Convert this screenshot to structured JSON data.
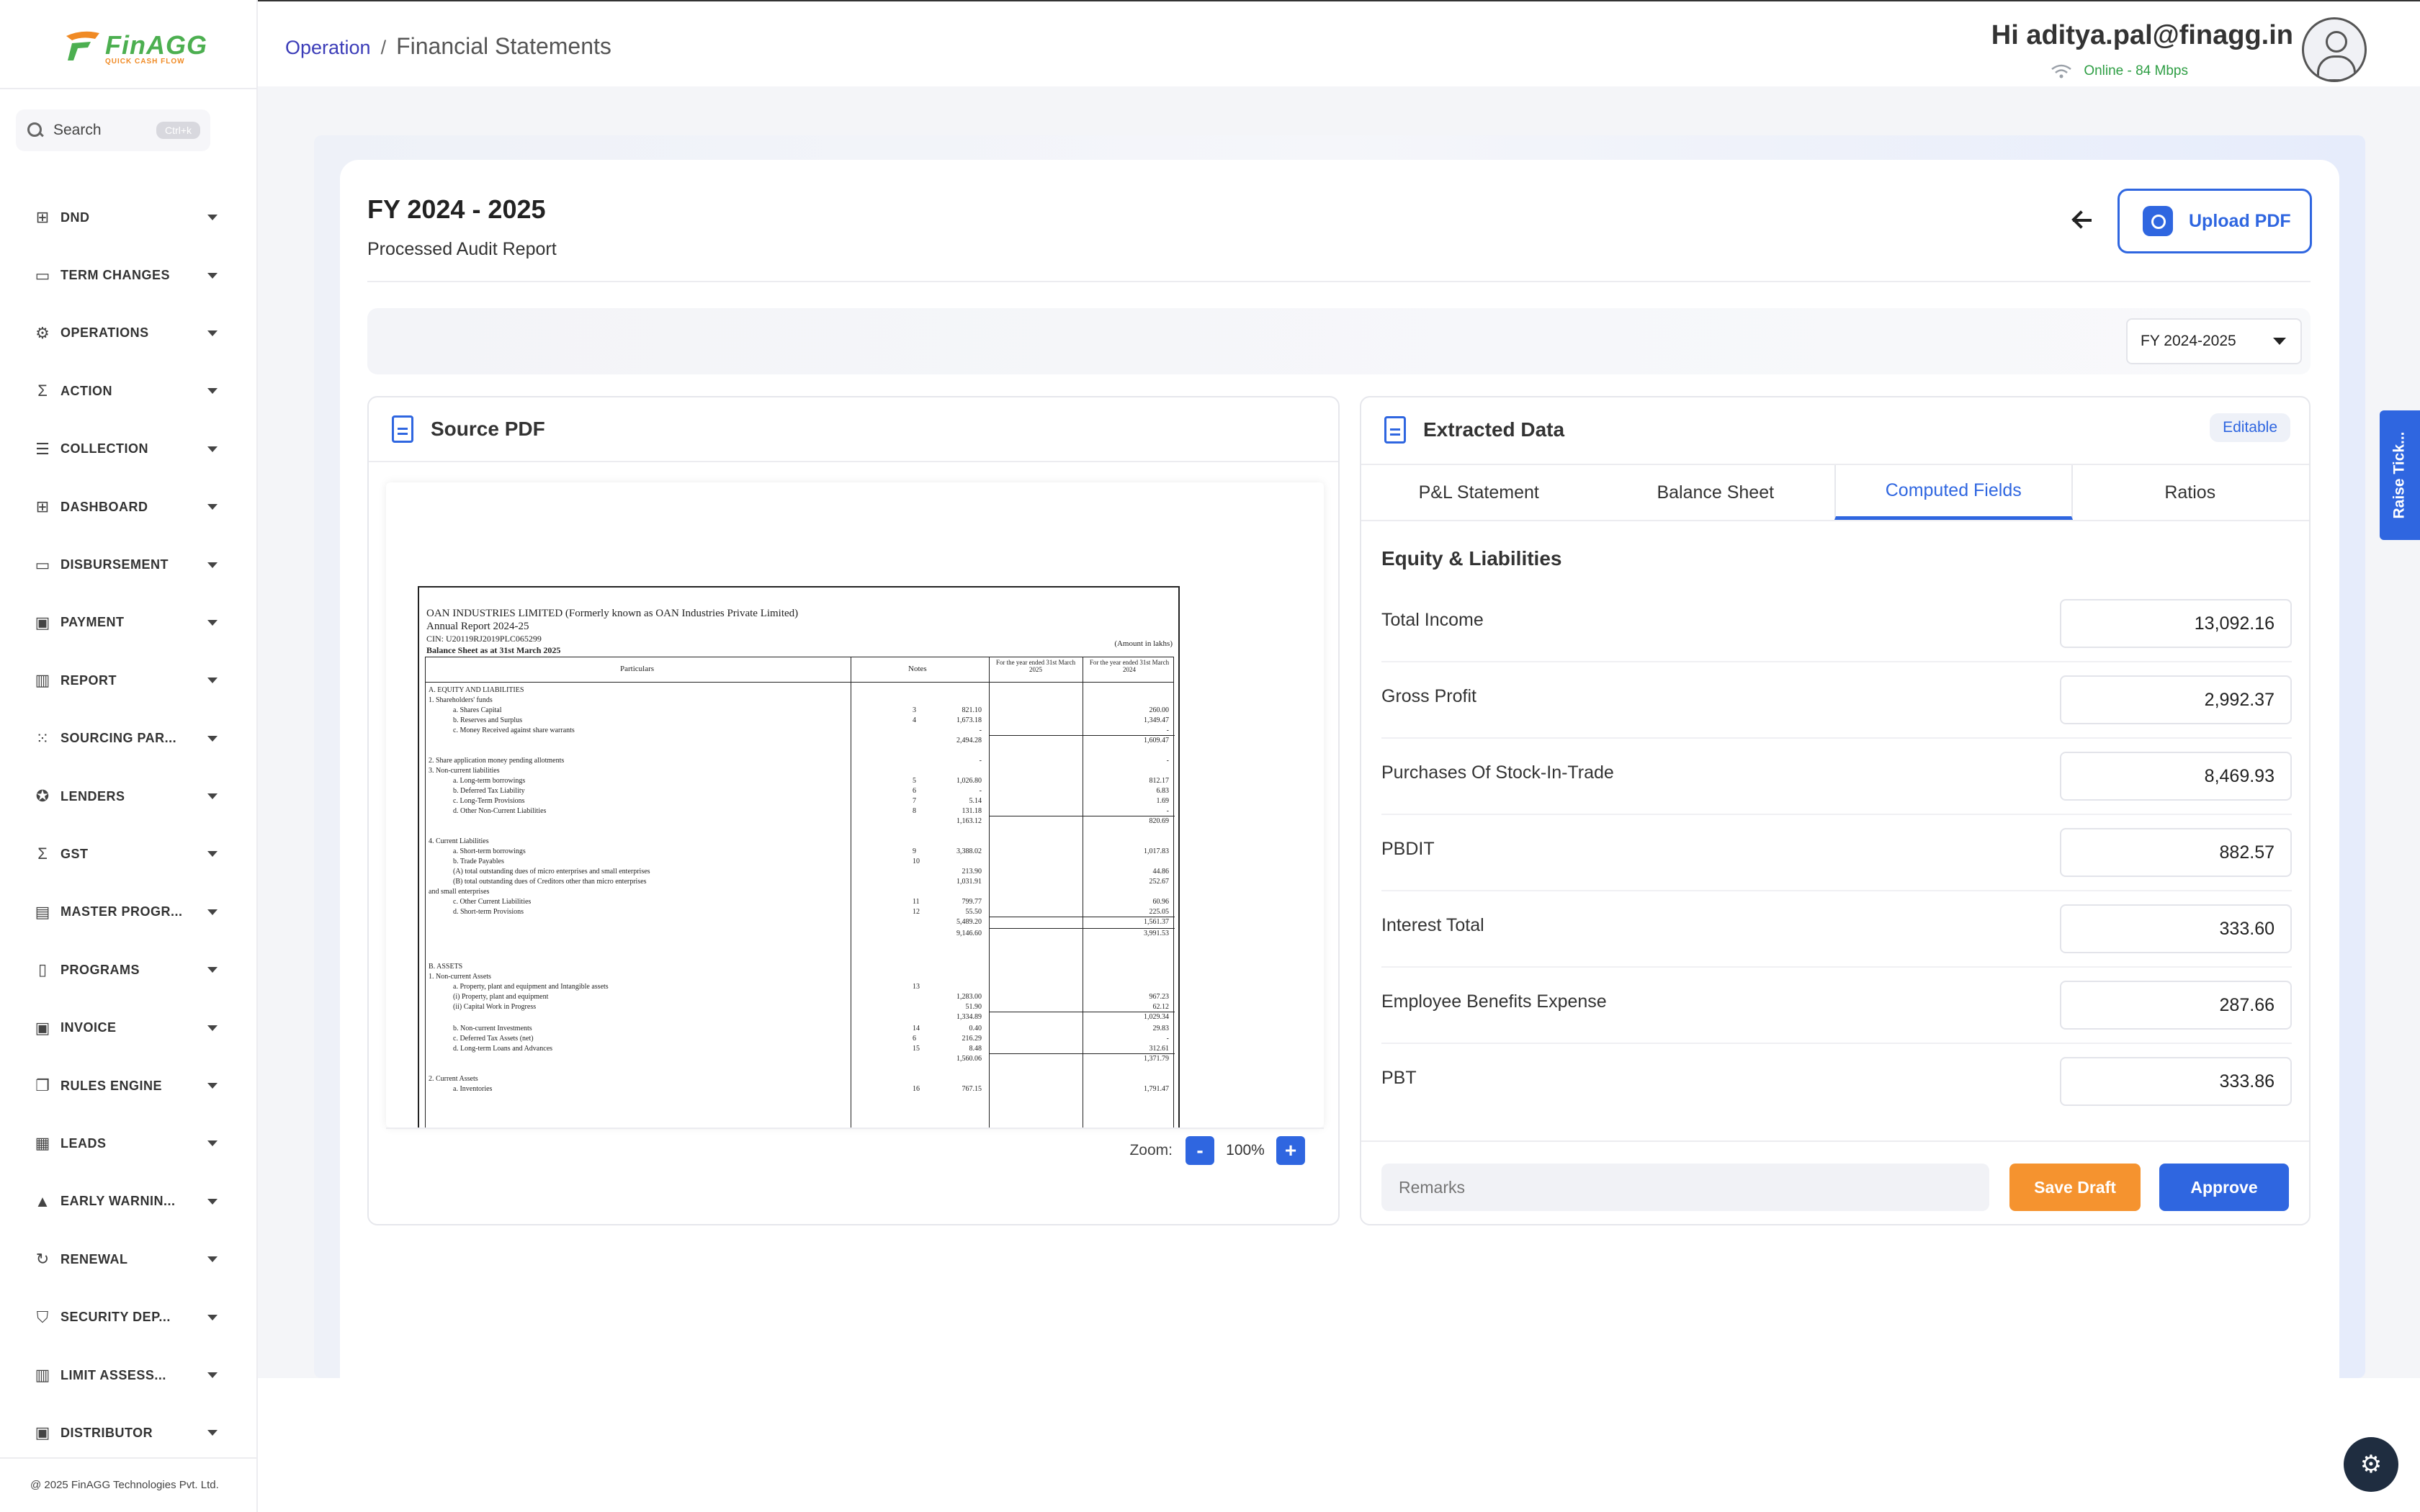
{
  "brand": {
    "name": "FinAGG",
    "tagline": "QUICK CASH FLOW",
    "copyright": "@ 2025 FinAGG Technologies Pvt. Ltd."
  },
  "search": {
    "placeholder": "Search",
    "shortcut": "Ctrl+k"
  },
  "sidebar": {
    "items": [
      {
        "label": "DND",
        "icon": "grid-icon",
        "glyph": "⊞"
      },
      {
        "label": "TERM CHANGES",
        "icon": "card-icon",
        "glyph": "▭"
      },
      {
        "label": "OPERATIONS",
        "icon": "gear-icon",
        "glyph": "⚙"
      },
      {
        "label": "ACTION",
        "icon": "sigma-icon",
        "glyph": "Σ"
      },
      {
        "label": "COLLECTION",
        "icon": "stack-icon",
        "glyph": "☰"
      },
      {
        "label": "DASHBOARD",
        "icon": "grid-icon",
        "glyph": "⊞"
      },
      {
        "label": "DISBURSEMENT",
        "icon": "card-icon",
        "glyph": "▭"
      },
      {
        "label": "PAYMENT",
        "icon": "payment-icon",
        "glyph": "▣"
      },
      {
        "label": "REPORT",
        "icon": "chart-icon",
        "glyph": "▥"
      },
      {
        "label": "SOURCING PAR...",
        "icon": "dots-grid-icon",
        "glyph": "⁙"
      },
      {
        "label": "LENDERS",
        "icon": "badge-icon",
        "glyph": "✪"
      },
      {
        "label": "GST",
        "icon": "sigma-icon",
        "glyph": "Σ"
      },
      {
        "label": "MASTER PROGR...",
        "icon": "book-icon",
        "glyph": "▤"
      },
      {
        "label": "PROGRAMS",
        "icon": "clipboard-icon",
        "glyph": "▯"
      },
      {
        "label": "INVOICE",
        "icon": "invoice-icon",
        "glyph": "▣"
      },
      {
        "label": "RULES ENGINE",
        "icon": "copy-icon",
        "glyph": "❐"
      },
      {
        "label": "LEADS",
        "icon": "briefcase-icon",
        "glyph": "▦"
      },
      {
        "label": "EARLY WARNIN...",
        "icon": "warning-icon",
        "glyph": "▲"
      },
      {
        "label": "RENEWAL",
        "icon": "refresh-icon",
        "glyph": "↻"
      },
      {
        "label": "SECURITY DEP...",
        "icon": "shield-icon",
        "glyph": "⛉"
      },
      {
        "label": "LIMIT ASSESS...",
        "icon": "chart-icon",
        "glyph": "▥"
      },
      {
        "label": "DISTRIBUTOR",
        "icon": "payment-icon",
        "glyph": "▣"
      }
    ]
  },
  "header": {
    "breadcrumb": {
      "link": "Operation",
      "separator": "/",
      "current": "Financial Statements"
    },
    "greeting": "Hi aditya.pal@finagg.in",
    "status": "Online - 84 Mbps"
  },
  "page": {
    "title": "FY 2024 - 2025",
    "subtitle": "Processed Audit Report",
    "upload_label": "Upload PDF",
    "fy_select": "FY 2024-2025"
  },
  "pdf": {
    "title": "Source PDF",
    "zoom_label": "Zoom:",
    "zoom_value": "100%",
    "zoom_minus": "-",
    "zoom_plus": "+",
    "doc": {
      "company": "OAN INDUSTRIES LIMITED (Formerly known as OAN Industries Private Limited)",
      "report": "Annual Report 2024-25",
      "cin": "CIN: U20119RJ2019PLC065299",
      "sheet": "Balance Sheet as at 31st March 2025",
      "amount_note": "(Amount in lakhs)",
      "col_particulars": "Particulars",
      "col_notes": "Notes",
      "col_cy": "For the year ended 31st March 2025",
      "col_py": "For the year ended 31st March 2024",
      "rows": [
        {
          "text": "A. EQUITY AND LIABILITIES",
          "note": "",
          "cy": "",
          "py": ""
        },
        {
          "text": "1. Shareholders' funds",
          "note": "",
          "cy": "",
          "py": ""
        },
        {
          "text": "a. Shares Capital",
          "note": "3",
          "cy": "821.10",
          "py": "260.00"
        },
        {
          "text": "b. Reserves and Surplus",
          "note": "4",
          "cy": "1,673.18",
          "py": "1,349.47"
        },
        {
          "text": "c. Money Received against share warrants",
          "note": "",
          "cy": "-",
          "py": "-"
        },
        {
          "text": "",
          "note": "",
          "cy": "2,494.28",
          "py": "1,609.47"
        },
        {
          "text": "2. Share application money pending allotments",
          "note": "",
          "cy": "-",
          "py": "-"
        },
        {
          "text": "3. Non-current liabilities",
          "note": "",
          "cy": "",
          "py": ""
        },
        {
          "text": "a. Long-term borrowings",
          "note": "5",
          "cy": "1,026.80",
          "py": "812.17"
        },
        {
          "text": "b. Deferred Tax Liability",
          "note": "6",
          "cy": "-",
          "py": "6.83"
        },
        {
          "text": "c. Long-Term Provisions",
          "note": "7",
          "cy": "5.14",
          "py": "1.69"
        },
        {
          "text": "d. Other Non-Current Liabilities",
          "note": "8",
          "cy": "131.18",
          "py": "-"
        },
        {
          "text": "",
          "note": "",
          "cy": "1,163.12",
          "py": "820.69"
        },
        {
          "text": "4. Current Liabilities",
          "note": "",
          "cy": "",
          "py": ""
        },
        {
          "text": "a. Short-term borrowings",
          "note": "9",
          "cy": "3,388.02",
          "py": "1,017.83"
        },
        {
          "text": "b. Trade Payables",
          "note": "10",
          "cy": "",
          "py": ""
        },
        {
          "text": "(A) total outstanding dues of micro enterprises and small enterprises",
          "note": "",
          "cy": "213.90",
          "py": "44.86"
        },
        {
          "text": "(B) total outstanding dues of Creditors other than micro enterprises",
          "note": "",
          "cy": "1,031.91",
          "py": "252.67"
        },
        {
          "text": "and small enterprises",
          "note": "",
          "cy": "",
          "py": ""
        },
        {
          "text": "c. Other Current Liabilities",
          "note": "11",
          "cy": "799.77",
          "py": "60.96"
        },
        {
          "text": "d. Short-term Provisions",
          "note": "12",
          "cy": "55.50",
          "py": "225.05"
        },
        {
          "text": "",
          "note": "",
          "cy": "5,489.20",
          "py": "1,561.37"
        },
        {
          "text": "",
          "note": "",
          "cy": "9,146.60",
          "py": "3,991.53"
        },
        {
          "text": "B. ASSETS",
          "note": "",
          "cy": "",
          "py": ""
        },
        {
          "text": "1. Non-current Assets",
          "note": "",
          "cy": "",
          "py": ""
        },
        {
          "text": "a. Property, plant and equipment and Intangible assets",
          "note": "13",
          "cy": "",
          "py": ""
        },
        {
          "text": "(i) Property, plant and equipment",
          "note": "",
          "cy": "1,283.00",
          "py": "967.23"
        },
        {
          "text": "(ii) Capital Work in Progress",
          "note": "",
          "cy": "51.90",
          "py": "62.12"
        },
        {
          "text": "",
          "note": "",
          "cy": "1,334.89",
          "py": "1,029.34"
        },
        {
          "text": "b. Non-current Investments",
          "note": "14",
          "cy": "0.40",
          "py": "29.83"
        },
        {
          "text": "c. Deferred Tax Assets (net)",
          "note": "6",
          "cy": "216.29",
          "py": "-"
        },
        {
          "text": "d. Long-term Loans and Advances",
          "note": "15",
          "cy": "8.48",
          "py": "312.61"
        },
        {
          "text": "",
          "note": "",
          "cy": "1,560.06",
          "py": "1,371.79"
        },
        {
          "text": "2. Current Assets",
          "note": "",
          "cy": "",
          "py": ""
        },
        {
          "text": "a. Inventories",
          "note": "16",
          "cy": "767.15",
          "py": "1,791.47"
        }
      ]
    }
  },
  "extracted": {
    "title": "Extracted Data",
    "badge": "Editable",
    "tabs": [
      "P&L Statement",
      "Balance Sheet",
      "Computed Fields",
      "Ratios"
    ],
    "active_tab": 2,
    "section": "Equity & Liabilities",
    "fields": [
      {
        "label": "Total Income",
        "value": "13,092.16"
      },
      {
        "label": "Gross Profit",
        "value": "2,992.37"
      },
      {
        "label": "Purchases Of Stock-In-Trade",
        "value": "8,469.93"
      },
      {
        "label": "PBDIT",
        "value": "882.57"
      },
      {
        "label": "Interest Total",
        "value": "333.60"
      },
      {
        "label": "Employee Benefits Expense",
        "value": "287.66"
      },
      {
        "label": "PBT",
        "value": "333.86"
      }
    ],
    "remarks_placeholder": "Remarks",
    "save_label": "Save Draft",
    "approve_label": "Approve"
  },
  "raise_ticket": "Raise Tick...",
  "colors": {
    "primary": "#2f66e0",
    "accent": "#f5932f",
    "success": "#2e9e44",
    "brand_green": "#4caf50"
  }
}
